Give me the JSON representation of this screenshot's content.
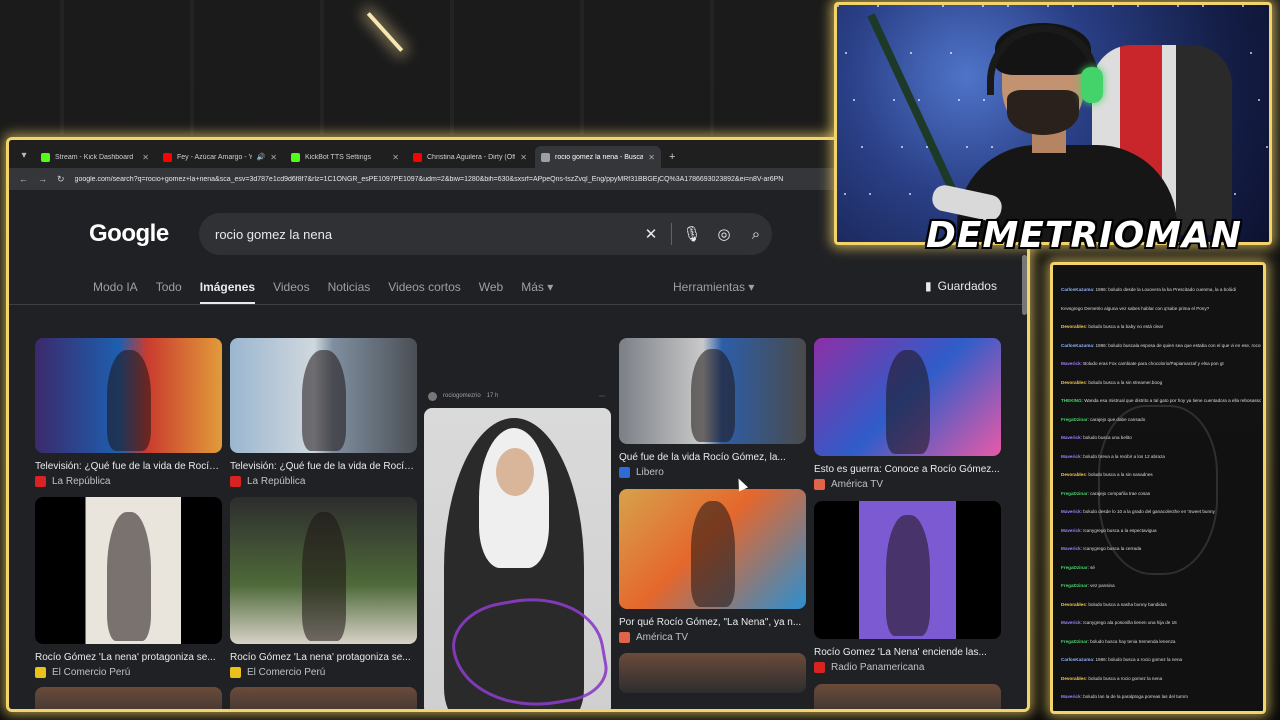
{
  "browser": {
    "tabs": [
      {
        "title": "Stream - Kick Dashboard",
        "favicon_color": "#53fc18",
        "active": false,
        "audio": false
      },
      {
        "title": "Fey - Azúcar Amargo - YouTube",
        "favicon_color": "#ff0000",
        "active": false,
        "audio": true
      },
      {
        "title": "KickBot TTS Settings",
        "favicon_color": "#53fc18",
        "active": false,
        "audio": false
      },
      {
        "title": "Christina Aguilera - Dirty (Official Video)",
        "favicon_color": "#ff0000",
        "active": false,
        "audio": false
      },
      {
        "title": "rocio gomez la nena - Buscar con Google",
        "favicon_color": "#9aa0a6",
        "active": true,
        "audio": false
      }
    ],
    "url": "google.com/search?q=rocio+gomez+la+nena&sca_esv=3d787e1cd9d6f8f7&rlz=1C1ONGR_esPE1097PE1097&udm=2&biw=1280&bih=630&sxsrf=APpeQns-tszZvqI_Eng/ppyMRf31BBGEjCQ%3A1786693023892&ei=n8V-ar6PN"
  },
  "google": {
    "logo": "Google",
    "query": "rocio gomez la nena",
    "filters": [
      "Modo IA",
      "Todo",
      "Imágenes",
      "Videos",
      "Noticias",
      "Videos cortos",
      "Web",
      "Más ▾"
    ],
    "active_filter": "Imágenes",
    "tools_label": "Herramientas ▾",
    "saved_label": "Guardados"
  },
  "results": [
    {
      "caption": "Televisión: ¿Qué fue de la vida de Rocío Gómez...",
      "source": "La República",
      "fav": "#d92323"
    },
    {
      "caption": "Televisión: ¿Qué fue de la vida de Rocío Gómez...",
      "source": "La República",
      "fav": "#d92323"
    },
    {
      "caption": "Qué fue de la vida Rocío Gómez, la...",
      "source": "Libero",
      "fav": "#2d6bd6"
    },
    {
      "caption": "Esto es guerra: Conoce a Rocío Gómez...",
      "source": "América TV",
      "fav": "#e0634a"
    },
    {
      "caption": "Rocío Gómez 'La nena' protagoniza se...",
      "source": "El Comercio Perú",
      "fav": "#e8c21a"
    },
    {
      "caption": "Rocío Gómez 'La nena' protagoniza se...",
      "source": "El Comercio Perú",
      "fav": "#e8c21a"
    },
    {
      "caption": "Por qué Rocío Gómez, \"La Nena\", ya n...",
      "source": "América TV",
      "fav": "#e0634a"
    },
    {
      "caption": "Rocío Gomez 'La Nena' enciende las...",
      "source": "Radio Panamericana",
      "fav": "#d92323"
    }
  ],
  "tall_result": {
    "account": "rociogomezrio",
    "time": "17 h"
  },
  "webcam": {
    "streamer_name": "DEMETRIOMAN"
  },
  "chat": [
    {
      "user": "CarlosKazuma",
      "text": ": 1986: boludo desde la Loxovera la ka Prescitado cuenma, la a bolúdi",
      "color": "#8ab4ff"
    },
    {
      "user": "",
      "text": "Kevsgrego Demetrio alguna vez sabes hablar con q'sabe prima el Pony?",
      "color": "#e8e8e8"
    },
    {
      "user": "Devorables",
      "text": ": boludo busca a la baby no está clear",
      "color": "#f7c948"
    },
    {
      "user": "CarlosKazuma",
      "text": ": 1986: boludo buscala esposa de quien sea que estaba con el que vi en ese, rocoso, nennena del 9",
      "color": "#8ab4ff"
    },
    {
      "user": "Maverick",
      "text": ": Boludo eras Fox cambiate para chocolorio/Papiamarzaf y elsa pon gt",
      "color": "#a27cff"
    },
    {
      "user": "Devorables",
      "text": ": boludo busca a la sin streamer.boog",
      "color": "#f7c948"
    },
    {
      "user": "THEKING",
      "text": ": Wanda esa mistrual que distrito a tal gato por hoy ya tiene cuentadora a ella rebosasso",
      "color": "#43d36a"
    },
    {
      "user": "FregaDzinar",
      "text": ": carajejo que dabe cansado",
      "color": "#43d36a"
    },
    {
      "user": "Maverick",
      "text": ": boludo busca una belito",
      "color": "#a27cff"
    },
    {
      "user": "Maverick",
      "text": ": boludo breva a la recibir a los 12 abraza",
      "color": "#a27cff"
    },
    {
      "user": "Devorables",
      "text": ": boludo busca a la sin sanadnes",
      "color": "#f7c948"
    },
    {
      "user": "FregaDzinar",
      "text": ": carajejo compañía trae cosas",
      "color": "#43d36a"
    },
    {
      "user": "Maverick",
      "text": ": boludo desde lo 10 a la grado del ganacolecthe en 'Sweet bunny",
      "color": "#a27cff"
    },
    {
      "user": "Maverick",
      "text": ": Icanygrego busca a la espectavigua",
      "color": "#a27cff"
    },
    {
      "user": "Maverick",
      "text": ": Icanygrego busca la cerrada",
      "color": "#a27cff"
    },
    {
      "user": "FregaDzinar",
      "text": ": sé",
      "color": "#43d36a"
    },
    {
      "user": "FregaDzinar",
      "text": ": vez pansina",
      "color": "#43d36a"
    },
    {
      "user": "Devorables",
      "text": ": boludo busca a sasha bunny bandidas",
      "color": "#f7c948"
    },
    {
      "user": "Maverick",
      "text": ": Icanygrego ala posonilla tienen una hija de 16",
      "color": "#a27cff"
    },
    {
      "user": "FregaDzinar",
      "text": ": boludo busca hay tenia tremenda lenenza",
      "color": "#43d36a"
    },
    {
      "user": "CarlosKazuma",
      "text": ": 1986: boludo busca a rocio gomez la nena",
      "color": "#8ab4ff"
    },
    {
      "user": "Devorables",
      "text": ": boludo busca a rocio gomez la nena",
      "color": "#f7c948"
    },
    {
      "user": "Maverick",
      "text": ": boludo lan la de la paralptoga porreas las del turnm",
      "color": "#a27cff"
    }
  ],
  "colors": {
    "frame_glow": "#f3d46b",
    "google_bg": "#202124"
  }
}
